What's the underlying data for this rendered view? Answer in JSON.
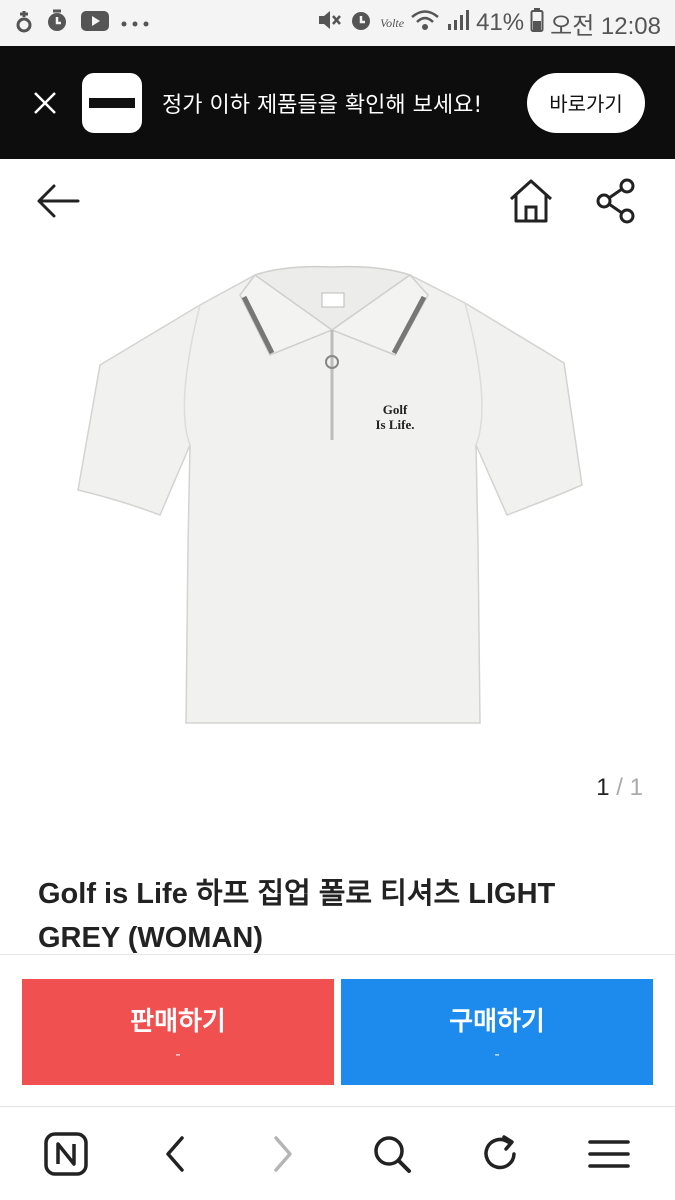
{
  "status_bar": {
    "icons_left": [
      "sync-icon",
      "alarm-icon",
      "youtube-icon",
      "more-icon"
    ],
    "icons_right": [
      "mute-icon",
      "alarm-icon",
      "volte-icon",
      "wifi-icon",
      "signal-icon"
    ],
    "volte_label": "Volte",
    "battery": "41%",
    "time": "오전 12:08"
  },
  "promo": {
    "text": "정가 이하 제품들을 확인해 보세요!",
    "button": "바로가기"
  },
  "product": {
    "image_counter_current": "1",
    "image_counter_sep": "/",
    "image_counter_total": "1",
    "shirt_print_line1": "Golf",
    "shirt_print_line2": "Is Life.",
    "title": "Golf is Life 하프 집업 폴로 티셔츠 LIGHT GREY (WOMAN)"
  },
  "actions": {
    "sell": {
      "label": "판매하기",
      "sub": "-"
    },
    "buy": {
      "label": "구매하기",
      "sub": "-"
    }
  },
  "colors": {
    "sell": "#f05050",
    "buy": "#1d8bee",
    "promo_bg": "#0d0d0d"
  }
}
